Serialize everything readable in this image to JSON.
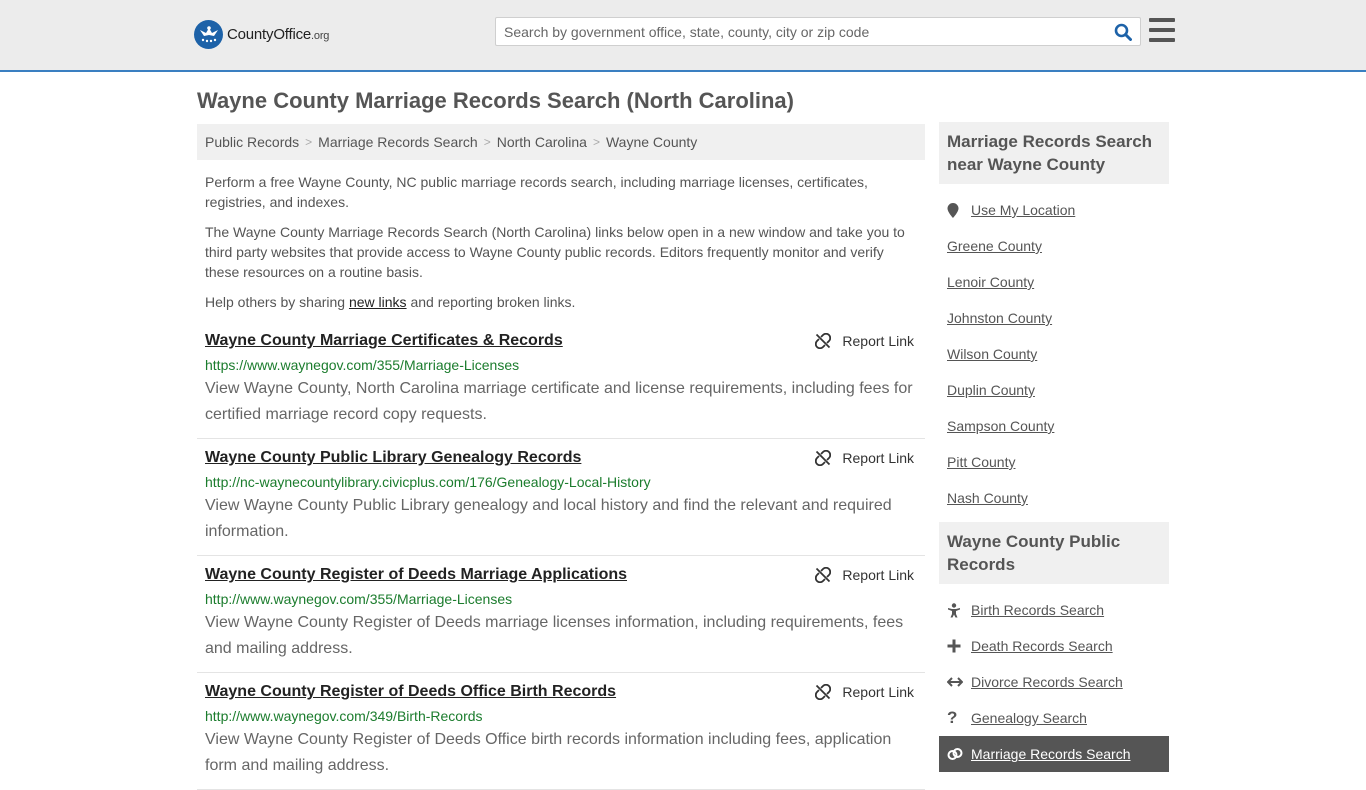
{
  "header": {
    "logo_brand": "CountyOffice",
    "logo_tld": ".org",
    "search_placeholder": "Search by government office, state, county, city or zip code"
  },
  "page_title": "Wayne County Marriage Records Search (North Carolina)",
  "breadcrumb": [
    "Public Records",
    "Marriage Records Search",
    "North Carolina",
    "Wayne County"
  ],
  "intro": {
    "p1": "Perform a free Wayne County, NC public marriage records search, including marriage licenses, certificates, registries, and indexes.",
    "p2": "The Wayne County Marriage Records Search (North Carolina) links below open in a new window and take you to third party websites that provide access to Wayne County public records. Editors frequently monitor and verify these resources on a routine basis.",
    "p3_before": "Help others by sharing ",
    "p3_link": "new links",
    "p3_after": " and reporting broken links."
  },
  "report_label": "Report Link",
  "results": [
    {
      "title": "Wayne County Marriage Certificates & Records",
      "url": "https://www.waynegov.com/355/Marriage-Licenses",
      "desc": "View Wayne County, North Carolina marriage certificate and license requirements, including fees for certified marriage record copy requests."
    },
    {
      "title": "Wayne County Public Library Genealogy Records",
      "url": "http://nc-waynecountylibrary.civicplus.com/176/Genealogy-Local-History",
      "desc": "View Wayne County Public Library genealogy and local history and find the relevant and required information."
    },
    {
      "title": "Wayne County Register of Deeds Marriage Applications",
      "url": "http://www.waynegov.com/355/Marriage-Licenses",
      "desc": "View Wayne County Register of Deeds marriage licenses information, including requirements, fees and mailing address."
    },
    {
      "title": "Wayne County Register of Deeds Office Birth Records",
      "url": "http://www.waynegov.com/349/Birth-Records",
      "desc": "View Wayne County Register of Deeds Office birth records information including fees, application form and mailing address."
    }
  ],
  "sidebar": {
    "nearby_heading": "Marriage Records Search near Wayne County",
    "use_location": "Use My Location",
    "nearby": [
      "Greene County",
      "Lenoir County",
      "Johnston County",
      "Wilson County",
      "Duplin County",
      "Sampson County",
      "Pitt County",
      "Nash County"
    ],
    "public_heading": "Wayne County Public Records",
    "public_items": [
      {
        "label": "Birth Records Search",
        "icon": "baby-icon"
      },
      {
        "label": "Death Records Search",
        "icon": "cross-icon"
      },
      {
        "label": "Divorce Records Search",
        "icon": "split-arrows-icon"
      },
      {
        "label": "Genealogy Search",
        "icon": "question-icon"
      },
      {
        "label": "Marriage Records Search",
        "icon": "rings-icon"
      }
    ]
  },
  "colors": {
    "accent_border": "#3a7fc1",
    "url_green": "#1b7c2d",
    "logo_blue": "#1d62a8"
  }
}
